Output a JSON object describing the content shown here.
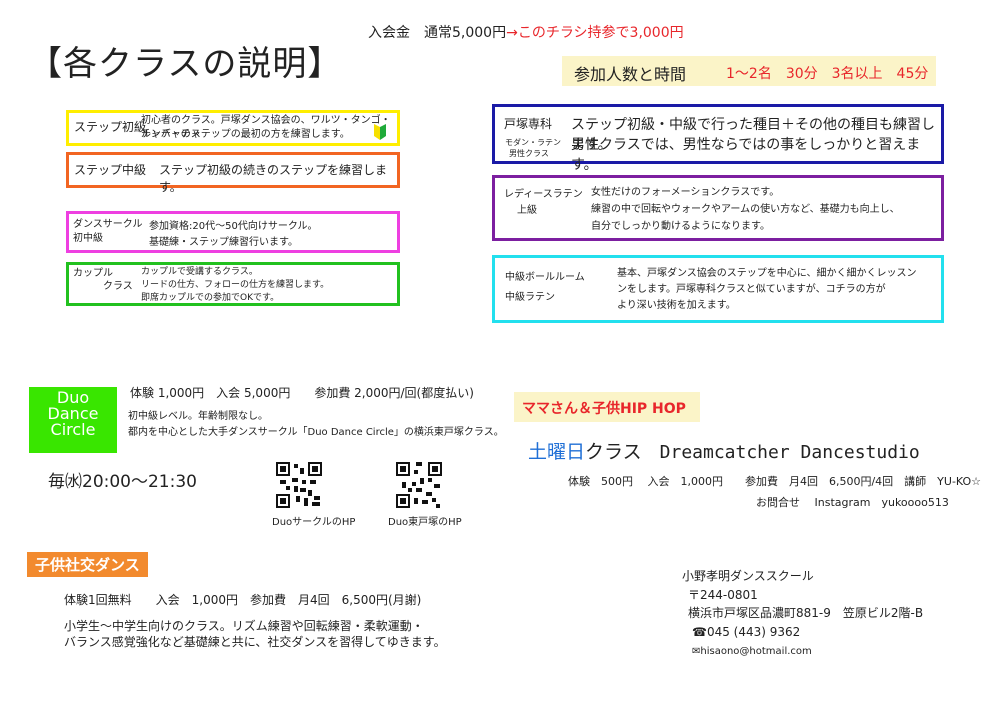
{
  "header": {
    "title": "【各クラスの説明】",
    "fee_normal": "入会金　通常5,000円",
    "fee_flyer": "→このチラシ持参で3,000円",
    "time_lead": "参加人数と時間",
    "time_rule": "1〜2名　30分　3名以上　45分"
  },
  "left_classes": [
    {
      "name": "ステップ初級",
      "desc": [
        "初心者のクラス。戸塚ダンス協会の、ワルツ・タンゴ・ルンバ・チャ",
        "チャチャのステップの最初の方を練習します。"
      ],
      "color": "#ffee00"
    },
    {
      "name": "ステップ中級",
      "desc": [
        "ステップ初級の続きのステップを練習します。"
      ],
      "color": "#f26522"
    },
    {
      "name": [
        "ダンスサークル",
        "初中級"
      ],
      "desc": [
        "参加資格:20代〜50代向けサークル。",
        "基礎練・ステップ練習行います。"
      ],
      "color": "#ee3fe1"
    },
    {
      "name": [
        "カップル",
        "クラス"
      ],
      "desc": [
        "カップルで受講するクラス。",
        "リードの仕方、フォローの仕方を練習します。",
        "即席カップルでの参加でOKです。"
      ],
      "color": "#22c11f"
    }
  ],
  "right_classes": [
    {
      "name": "戸塚専科",
      "sub": [
        "モダン・ラテン",
        "男性クラス"
      ],
      "desc": [
        "ステップ初級・中級で行った種目＋その他の種目も練習します。",
        "男性クラスでは、男性ならではの事をしっかりと習えます。"
      ],
      "color": "#1a1aa6"
    },
    {
      "name": [
        "レディースラテン",
        "上級"
      ],
      "desc": [
        "女性だけのフォーメーションクラスです。",
        "練習の中で回転やウォークやアームの使い方など、基礎力も向上し、",
        "自分でしっかり動けるようになります。"
      ],
      "color": "#7c1fa0"
    },
    {
      "name": [
        "中級ボールルーム",
        "中級ラテン"
      ],
      "desc": [
        "基本、戸塚ダンス協会のステップを中心に、細かく細かくレッスン",
        "ンをします。戸塚専科クラスと似ていますが、コチラの方が",
        "より深い技術を加えます。"
      ],
      "color": "#22e0ee"
    }
  ],
  "duo": {
    "logo": [
      "Duo",
      "Dance",
      "Circle"
    ],
    "fees": "体験 1,000円　入会 5,000円　　参加費 2,000円/回(都度払い)",
    "desc1": "初中級レベル。年齢制限なし。",
    "desc2": "都内を中心とした大手ダンスサークル「Duo Dance Circle」の横浜東戸塚クラス。",
    "schedule": "毎㈬20:00〜21:30",
    "qr1_label": "DuoサークルのHP",
    "qr2_label": "Duo東戸塚のHP"
  },
  "kids": {
    "label": "子供社交ダンス",
    "fees": "体験1回無料　　入会　1,000円　参加費　月4回　6,500円(月謝)",
    "desc1": "小学生〜中学生向けのクラス。リズム練習や回転練習・柔軟運動・",
    "desc2": "バランス感覚強化など基礎練と共に、社交ダンスを習得してゆきます。"
  },
  "hiphop": {
    "label": "ママさん＆子供HIP HOP",
    "day": "土曜日",
    "class_word": "クラス",
    "studio": "Dreamcatcher Dancestudio",
    "fees": "体験　500円　 入会　1,000円　　参加費　月4回　6,500円/4回　講師　YU-KO☆",
    "contact": "お問合せ　 Instagram　yukoooo513"
  },
  "school": {
    "name": "小野孝明ダンススクール",
    "zip": "〒244-0801",
    "address": "横浜市戸塚区品濃町881-9　笠原ビル2階-B",
    "tel": "045 (443) 9362",
    "email": "hisaono@hotmail.com"
  }
}
